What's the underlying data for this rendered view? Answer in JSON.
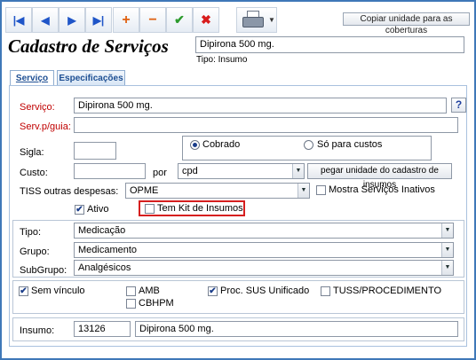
{
  "toolbar": {
    "buttons": [
      {
        "name": "first-record-button",
        "icon": "first-icon",
        "glyph": "|◀",
        "tone": "blue"
      },
      {
        "name": "previous-record-button",
        "icon": "previous-icon",
        "glyph": "◀",
        "tone": "blue"
      },
      {
        "name": "next-record-button",
        "icon": "next-icon",
        "glyph": "▶",
        "tone": "blue"
      },
      {
        "name": "last-record-button",
        "icon": "last-icon",
        "glyph": "▶|",
        "tone": "blue"
      },
      {
        "name": "add-record-button",
        "icon": "plus-icon",
        "glyph": "+",
        "tone": "orange"
      },
      {
        "name": "delete-record-button",
        "icon": "minus-icon",
        "glyph": "−",
        "tone": "orange"
      },
      {
        "name": "confirm-button",
        "icon": "check-icon",
        "glyph": "✔",
        "tone": "green"
      },
      {
        "name": "cancel-button",
        "icon": "x-icon",
        "glyph": "✖",
        "tone": "red"
      }
    ],
    "print_icon": "printer-icon",
    "copy_button_label": "Copiar unidade para as coberturas"
  },
  "header": {
    "title": "Cadastro de Serviços",
    "service_name": "Dipirona 500 mg.",
    "tipo_text": "Tipo: Insumo"
  },
  "tabs": [
    {
      "label": "Serviço",
      "active": true
    },
    {
      "label": "Especificações",
      "active": false
    }
  ],
  "form": {
    "servico_label": "Serviço:",
    "servico_value": "Dipirona 500 mg.",
    "help_glyph": "?",
    "serv_guia_label": "Serv.p/guia:",
    "serv_guia_value": "",
    "sigla_label": "Sigla:",
    "sigla_value": "",
    "cobrado_label": "Cobrado",
    "so_custos_label": "Só para custos",
    "selected_billing": "Cobrado",
    "custo_label": "Custo:",
    "custo_value": "",
    "por_label": "por",
    "unidade_value": "cpd",
    "pegar_unidade_label": "pegar unidade do cadastro de insumos",
    "tiss_label": "TISS outras despesas:",
    "tiss_value": "OPME",
    "mostra_inativos_label": "Mostra Serviços Inativos",
    "mostra_inativos_checked": false,
    "ativo_label": "Ativo",
    "ativo_checked": true,
    "tem_kit_label": "Tem Kit de Insumos",
    "tem_kit_checked": false,
    "tipo_label": "Tipo:",
    "tipo_value": "Medicação",
    "grupo_label": "Grupo:",
    "grupo_value": "Medicamento",
    "subgrupo_label": "SubGrupo:",
    "subgrupo_value": "Analgésicos",
    "sem_vinculo_label": "Sem vínculo",
    "sem_vinculo_checked": true,
    "amb_label": "AMB",
    "amb_checked": false,
    "cbhpm_label": "CBHPM",
    "cbhpm_checked": false,
    "proc_sus_label": "Proc. SUS Unificado",
    "proc_sus_checked": true,
    "tuss_label": "TUSS/PROCEDIMENTO",
    "tuss_checked": false,
    "insumo_label": "Insumo:",
    "insumo_code": "13126",
    "insumo_name": "Dipirona 500 mg."
  },
  "colors": {
    "frame_border": "#3f78b8",
    "required_label": "#c00000",
    "highlight_border": "#d61f1f"
  }
}
